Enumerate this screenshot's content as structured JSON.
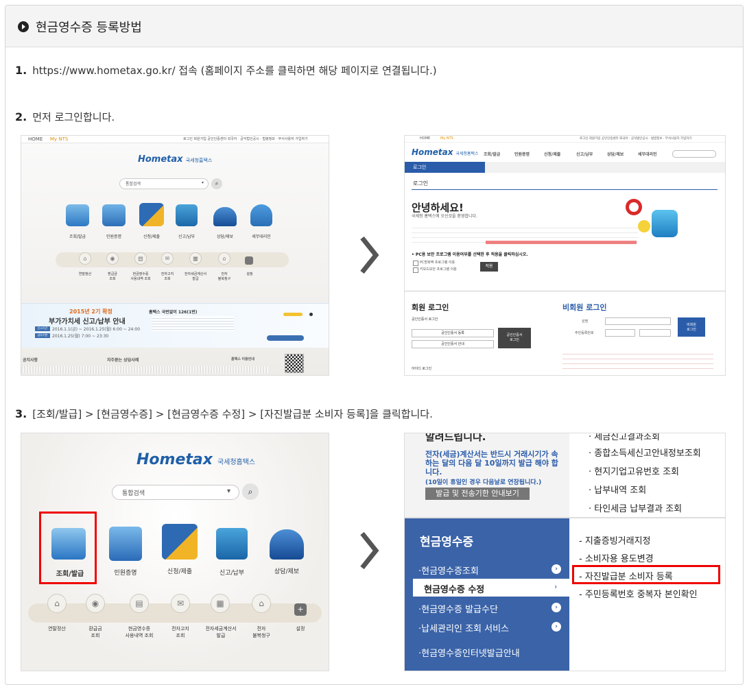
{
  "header": {
    "title": "현금영수증 등록방법",
    "icon": "circle-play-icon"
  },
  "steps": [
    {
      "num": "1.",
      "text": "https://www.hometax.go.kr/ 접속 (홈페이지 주소를 클릭하면 해당 페이지로 연결됩니다.)"
    },
    {
      "num": "2.",
      "text": "먼저 로그인합니다."
    },
    {
      "num": "3.",
      "text": "[조회/발급] > [현금영수증] > [현금영수증 수정] > [자진발급분 소비자 등록]을 클릭합니다."
    }
  ],
  "hometax": {
    "logo": "Hometax",
    "logo_sub": "국세청홈택스",
    "search_placeholder": "통합검색",
    "top_links": [
      "HOME",
      "My NTS"
    ],
    "top_right": "로그인 회원가입 공인인증센터 외국어 · 공익법인공시 · 법령정보 · 부서사용자 가입하기",
    "main_icons": [
      "조회/발급",
      "민원증명",
      "신청/제출",
      "신고/납부",
      "상담/제보",
      "세무대리인"
    ],
    "main_icons_big": [
      "조회/발급",
      "민원증명",
      "신청/제출",
      "신고/납부",
      "상담/제보"
    ],
    "sub_icons": [
      "연말정산",
      "환급금\n조회",
      "현금영수증\n사용내역 조회",
      "전자고지\n조회",
      "전자세금계산서\n발급",
      "전자\n불복청구",
      "설정"
    ],
    "banner": {
      "line1": "2015년 2기 확정",
      "line2": "부가가치세 신고/납부 안내",
      "d1": "2016.1.1(금) ~ 2016.1.25(월) 6:00 ~ 24:00",
      "d2": "2016.1.25(월) 7:00 ~ 23:30",
      "right_title": "홈택스 국번없이 126(1번)",
      "tags": [
        "신고기간",
        "납부기한"
      ]
    },
    "bottom": [
      "공지사항",
      "자주묻는 상담사례",
      "홈택스 이용안내"
    ]
  },
  "login": {
    "nav": [
      "조회/발급",
      "민원증명",
      "신청/제출",
      "신고/납부",
      "상담/제보",
      "세무대리인"
    ],
    "breadcrumb": "로그인",
    "page_title": "로그인",
    "hello": "안녕하세요!",
    "welcome": "국세청 홈택스에 오신것을 환영합니다.",
    "notice": "• PC용 보안 프로그램 이용여부를 선택한 후 적용을 클릭하십시오.",
    "opt1": "PC방화벽 프로그램 이용",
    "opt2": "키보드보안 프로그램 이용",
    "apply": "적용",
    "member_login": "회원 로그인",
    "cert_login": "공인인증서 로그인",
    "cert_reg": "공인인증서 등록",
    "cert_guide": "공인인증서 안내",
    "cert_btn": "공인인증서\n로그인",
    "nonmember_login": "비회원 로그인",
    "name_label": "성명",
    "rrn_label": "주민등록번호",
    "nonmember_btn": "비회원\n로그인",
    "id_login": "아이디 로그인"
  },
  "cash_menu": {
    "notice_top": "알려드립니다.",
    "notice_text": "전자(세금)계산서는 반드시 거래시기가 속하는 달의 다음 달 10일까지 발급 해야 합니다.",
    "notice_sub": "(10일이 휴일인 경우 다음날로 연장됩니다.)",
    "notice_btn": "발급 및 전송기한 안내보기",
    "right_list": [
      "· 세금신고결과조회",
      "· 종합소득세신고안내정보조회",
      "· 현지기업고유번호 조회",
      "· 납부내역 조회",
      "· 타인세금 납부결과 조회"
    ],
    "section_title": "현금영수증",
    "menu": [
      "·현금영수증조회",
      "현금영수증 수정",
      "·현금영수증 발급수단",
      "·납세관리인 조회 서비스",
      "·현금영수증인터넷발급안내"
    ],
    "submenu": [
      "- 지출증빙거래지정",
      "- 소비자용 용도변경",
      "- 자진발급분 소비자 등록",
      "- 주민등록번호 중복자 본인확인"
    ]
  },
  "colors": {
    "accent": "#2f5b9d",
    "highlight": "#e00000",
    "menu_active": "#ffffff"
  }
}
